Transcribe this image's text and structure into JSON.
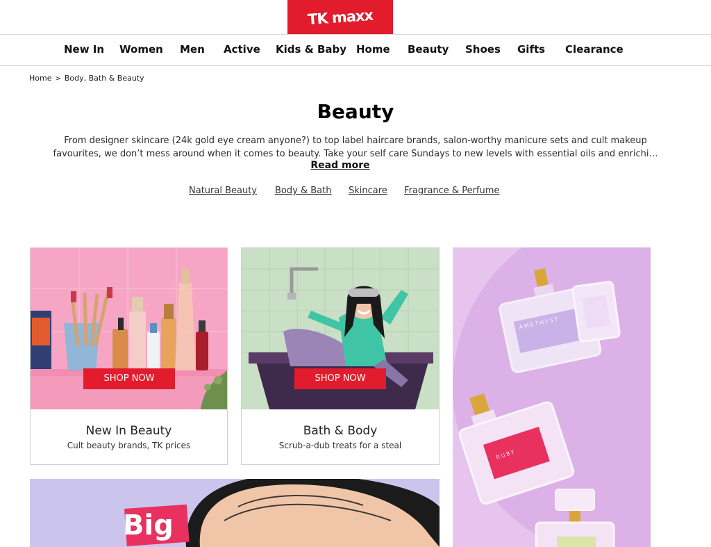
{
  "brand": {
    "logo_text": "TK maxx",
    "accent": "#e21c2c"
  },
  "nav": {
    "items": [
      {
        "label": "New In"
      },
      {
        "label": "Women"
      },
      {
        "label": "Men"
      },
      {
        "label": "Active"
      },
      {
        "label": "Kids & Baby"
      },
      {
        "label": "Home"
      },
      {
        "label": "Beauty"
      },
      {
        "label": "Shoes"
      },
      {
        "label": "Gifts"
      },
      {
        "label": "Clearance"
      }
    ]
  },
  "breadcrumb": {
    "home": "Home",
    "separator": ">",
    "current": "Body, Bath & Beauty"
  },
  "page": {
    "title": "Beauty",
    "description_line1": "From designer skincare (24k gold eye cream anyone?) to top label haircare brands, salon-worthy manicure sets and cult makeup",
    "description_line2": "favourites, we don’t mess around when it comes to beauty. Take your self care Sundays to new levels with essential oils and enrichi…",
    "read_more": "Read more"
  },
  "category_links": [
    {
      "label": "Natural Beauty"
    },
    {
      "label": "Body & Bath"
    },
    {
      "label": "Skincare"
    },
    {
      "label": "Fragrance & Perfume"
    }
  ],
  "cards": [
    {
      "button": "SHOP NOW",
      "title": "New In Beauty",
      "subtitle": "Cult beauty brands, TK prices"
    },
    {
      "button": "SHOP NOW",
      "title": "Bath & Body",
      "subtitle": "Scrub-a-dub treats for a steal"
    }
  ],
  "promo_bottom": {
    "text": "Big"
  },
  "promo_tall": {
    "bottle_label_1": "AMETHYST",
    "bottle_label_2": "RUBY"
  }
}
